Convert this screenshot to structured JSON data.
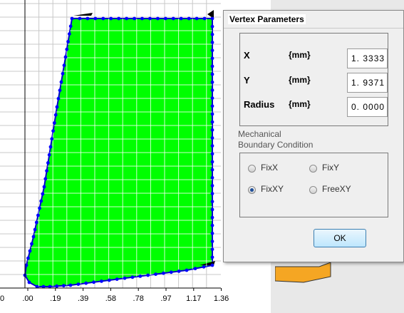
{
  "plot": {
    "x_tick_labels": [
      ".00",
      ".19",
      ".39",
      ".58",
      ".78",
      ".97",
      "1.17",
      "1.36"
    ],
    "left_edge_label": "0",
    "fill_color": "#00ff00",
    "vertex_color": "#0000ff"
  },
  "dialog": {
    "title": "Vertex Parameters",
    "params": [
      {
        "label": "X",
        "unit": "{mm}",
        "value": "1. 3333"
      },
      {
        "label": "Y",
        "unit": "{mm}",
        "value": "1. 9371"
      },
      {
        "label": "Radius",
        "unit": "{mm}",
        "value": "0. 0000"
      }
    ],
    "mech_label_line1": "Mechanical",
    "mech_label_line2": "Boundary Condition",
    "conditions": [
      {
        "label": "FixX",
        "checked": false
      },
      {
        "label": "FixY",
        "checked": false
      },
      {
        "label": "FixXY",
        "checked": true
      },
      {
        "label": "FreeXY",
        "checked": false
      }
    ],
    "ok_label": "OK"
  },
  "colors": {
    "accent": "#3c7fb1",
    "background_shape": "#f5a623"
  }
}
